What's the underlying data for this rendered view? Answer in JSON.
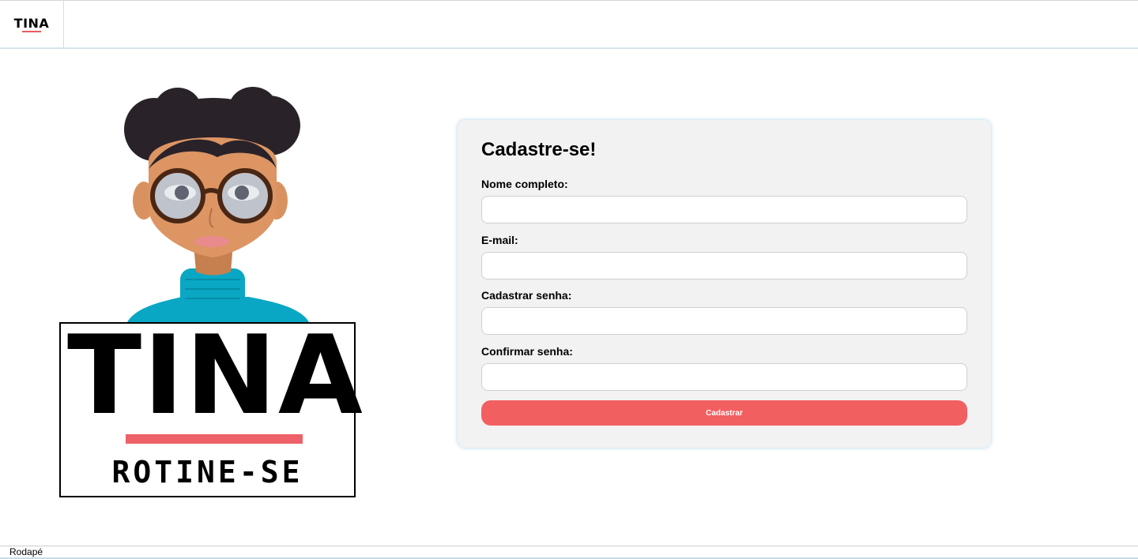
{
  "header": {
    "logo_text": "TINA"
  },
  "brand": {
    "title": "TINA",
    "subtitle": "ROTINE-SE",
    "accent_color": "#ee6168"
  },
  "form": {
    "title": "Cadastre-se!",
    "fields": [
      {
        "label": "Nome completo:",
        "value": "",
        "placeholder": ""
      },
      {
        "label": "E-mail:",
        "value": "",
        "placeholder": ""
      },
      {
        "label": "Cadastrar senha:",
        "value": "",
        "placeholder": ""
      },
      {
        "label": "Confirmar senha:",
        "value": "",
        "placeholder": ""
      }
    ],
    "submit_label": "Cadastrar",
    "button_color": "#f25f61"
  },
  "footer": {
    "text": "Rodapé"
  }
}
